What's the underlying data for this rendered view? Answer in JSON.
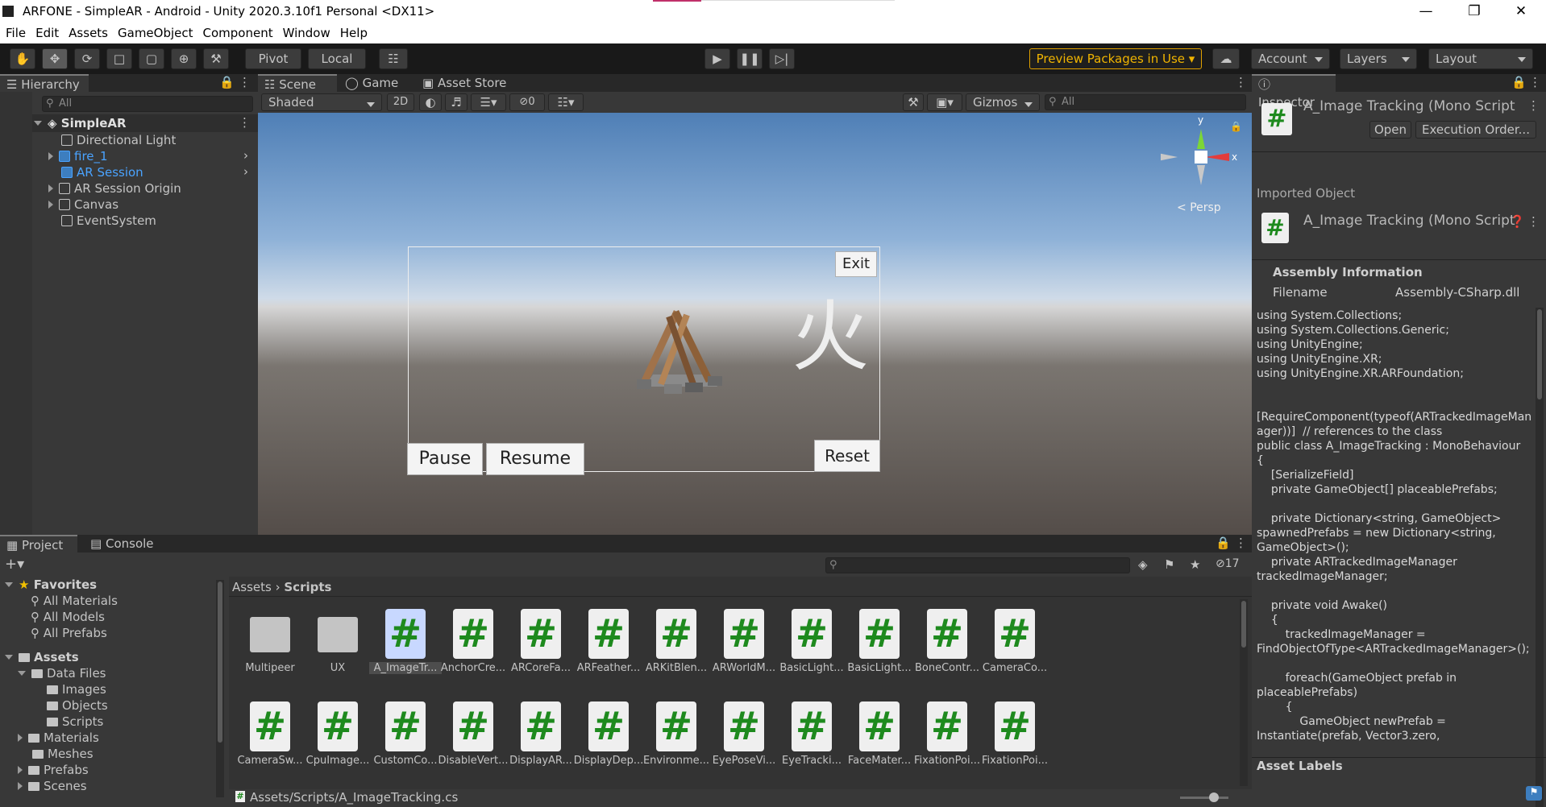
{
  "window": {
    "title": "ARFONE - SimpleAR - Android - Unity 2020.3.10f1 Personal <DX11>"
  },
  "menu": [
    "File",
    "Edit",
    "Assets",
    "GameObject",
    "Component",
    "Window",
    "Help"
  ],
  "toolbar": {
    "pivot": "Pivot",
    "local": "Local",
    "preview": "Preview Packages in Use",
    "account": "Account",
    "layers": "Layers",
    "layout": "Layout"
  },
  "hierarchy": {
    "tab": "Hierarchy",
    "search_placeholder": "All",
    "scene": "SimpleAR",
    "items": [
      "Directional Light",
      "fire_1",
      "AR Session",
      "AR Session Origin",
      "Canvas",
      "EventSystem"
    ]
  },
  "scene": {
    "tabs": [
      "Scene",
      "Game",
      "Asset Store"
    ],
    "shading": "Shaded",
    "mode_2d": "2D",
    "hidden_count": "0",
    "gizmos": "Gizmos",
    "search_placeholder": "All",
    "persp": "Persp",
    "axis_x": "x",
    "axis_y": "y",
    "buttons": {
      "exit": "Exit",
      "pause": "Pause",
      "resume": "Resume",
      "reset": "Reset"
    },
    "glyph": "火"
  },
  "inspector": {
    "tab": "Inspector",
    "script_title": "A_Image Tracking (Mono Script",
    "open": "Open",
    "execution_order": "Execution Order...",
    "imported_object": "Imported Object",
    "imported_title": "A_Image Tracking (Mono Script",
    "assembly_info": "Assembly Information",
    "filename_label": "Filename",
    "filename_value": "Assembly-CSharp.dll",
    "code": "using System.Collections;\nusing System.Collections.Generic;\nusing UnityEngine;\nusing UnityEngine.XR;\nusing UnityEngine.XR.ARFoundation;\n\n\n[RequireComponent(typeof(ARTrackedImageManager))]  // references to the class\npublic class A_ImageTracking : MonoBehaviour\n{\n    [SerializeField]\n    private GameObject[] placeablePrefabs;\n\n    private Dictionary<string, GameObject> spawnedPrefabs = new Dictionary<string, GameObject>();\n    private ARTrackedImageManager trackedImageManager;\n\n    private void Awake()\n    {\n        trackedImageManager = FindObjectOfType<ARTrackedImageManager>();\n\n        foreach(GameObject prefab in placeablePrefabs)\n        {\n            GameObject newPrefab = Instantiate(prefab, Vector3.zero,",
    "asset_labels": "Asset Labels"
  },
  "project": {
    "tabs": [
      "Project",
      "Console"
    ],
    "hidden_count": "17",
    "favorites_label": "Favorites",
    "favorites": [
      "All Materials",
      "All Models",
      "All Prefabs"
    ],
    "assets_label": "Assets",
    "tree": [
      {
        "label": "Data Files",
        "level": 1,
        "expanded": true
      },
      {
        "label": "Images",
        "level": 2
      },
      {
        "label": "Objects",
        "level": 2
      },
      {
        "label": "Scripts",
        "level": 2
      },
      {
        "label": "Materials",
        "level": 1
      },
      {
        "label": "Meshes",
        "level": 1
      },
      {
        "label": "Prefabs",
        "level": 1
      },
      {
        "label": "Scenes",
        "level": 1
      }
    ],
    "breadcrumb": [
      "Assets",
      "Scripts"
    ],
    "assets_row1": [
      "Multipeer",
      "UX",
      "A_ImageTr...",
      "AnchorCre...",
      "ARCoreFa...",
      "ARFeather...",
      "ARKitBlen...",
      "ARWorldM...",
      "BasicLight...",
      "BasicLight...",
      "BoneContr...",
      "CameraCo..."
    ],
    "assets_row2": [
      "CameraSw...",
      "CpuImage...",
      "CustomCo...",
      "DisableVert...",
      "DisplayAR...",
      "DisplayDep...",
      "Environme...",
      "EyePoseVi...",
      "EyeTracki...",
      "FaceMater...",
      "FixationPoi...",
      "FixationPoi..."
    ],
    "status_path": "Assets/Scripts/A_ImageTracking.cs"
  },
  "colors": {
    "accent": "#4aa3ff",
    "preview_border": "#e0a000",
    "script_hash": "#1e8a1e"
  }
}
